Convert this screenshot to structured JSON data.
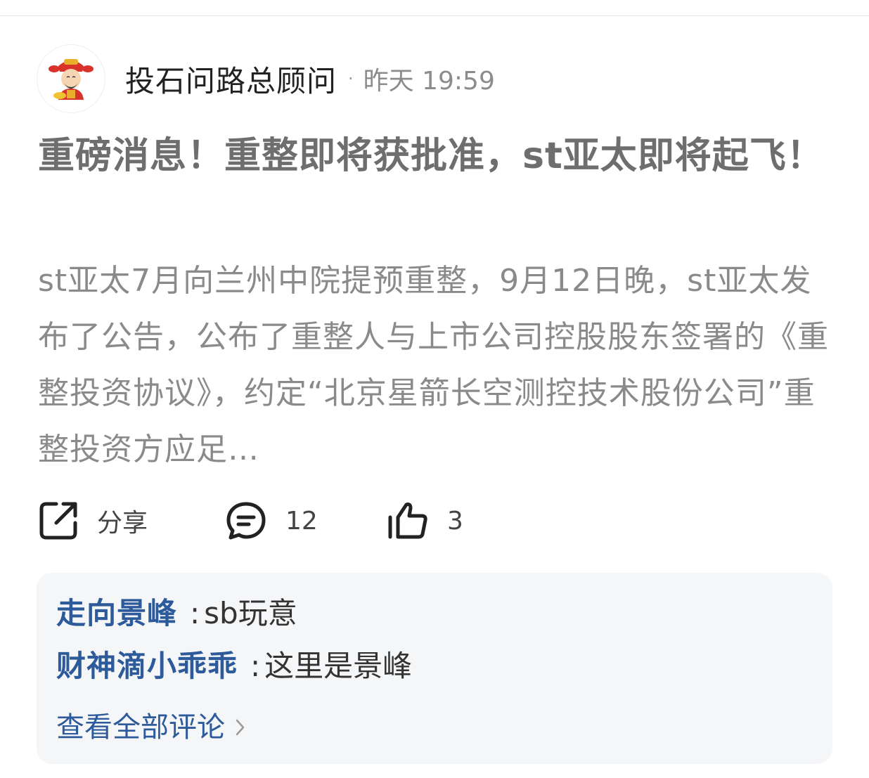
{
  "author": {
    "name": "投石问路总顾问",
    "separator": "·",
    "time": "昨天 19:59"
  },
  "post": {
    "title": "重磅消息！重整即将获批准，st亚太即将起飞！",
    "body": "st亚太7月向兰州中院提预重整，9月12日晚，st亚太发布了公告，公布了重整人与上市公司控股股东签署的《重整投资协议》，约定“北京星箭长空测控技术股份公司”重整投资方应足…"
  },
  "actions": {
    "share_label": "分享",
    "comment_count": "12",
    "like_count": "3"
  },
  "comments": {
    "items": [
      {
        "user": "走向景峰",
        "sep": ":",
        "text": "sb玩意"
      },
      {
        "user": "财神滴小乖乖",
        "sep": ":",
        "text": "这里是景峰"
      }
    ],
    "view_all_label": "查看全部评论"
  },
  "colors": {
    "link_blue": "#2d5a9a",
    "title_gray": "#6e6e6e",
    "body_gray": "#8a8a8a",
    "comment_bg": "#f5f6f8"
  }
}
